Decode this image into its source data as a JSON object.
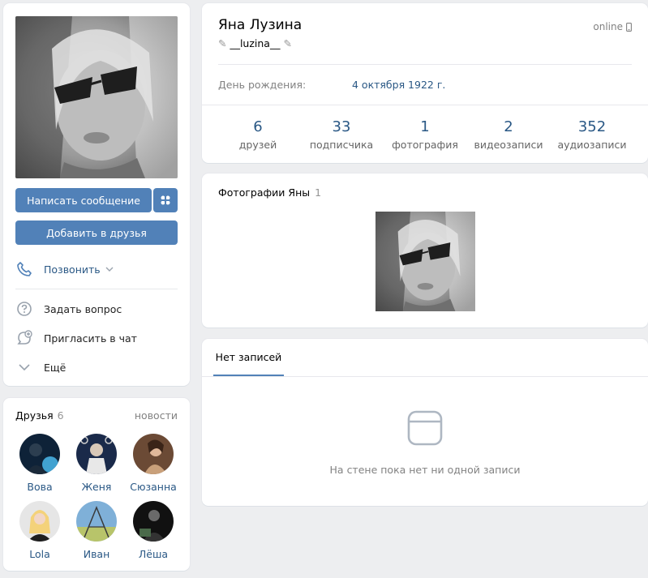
{
  "profile": {
    "name": "Яна Лузина",
    "status": "__luzina__",
    "online": "online",
    "birthday_label": "День рождения:",
    "birthday_value": "4 октября 1922 г."
  },
  "counters": [
    {
      "num": "6",
      "label": "друзей"
    },
    {
      "num": "33",
      "label": "подписчика"
    },
    {
      "num": "1",
      "label": "фотография"
    },
    {
      "num": "2",
      "label": "видеозаписи"
    },
    {
      "num": "352",
      "label": "аудиозаписи"
    }
  ],
  "actions": {
    "send_message": "Написать сообщение",
    "add_friend": "Добавить в друзья",
    "call": "Позвонить",
    "ask_question": "Задать вопрос",
    "invite_chat": "Пригласить в чат",
    "more": "Ещё"
  },
  "photos": {
    "title": "Фотографии Яны",
    "count": "1"
  },
  "wall": {
    "tab": "Нет записей",
    "empty": "На стене пока нет ни одной записи"
  },
  "friends": {
    "title": "Друзья",
    "count": "6",
    "news": "новости",
    "items": [
      {
        "name": "Вова"
      },
      {
        "name": "Женя"
      },
      {
        "name": "Сюзанна"
      },
      {
        "name": "Lola"
      },
      {
        "name": "Иван"
      },
      {
        "name": "Лёша"
      }
    ]
  },
  "colors": {
    "accent": "#5181b8",
    "link": "#2a5885",
    "background": "#edeef0"
  }
}
